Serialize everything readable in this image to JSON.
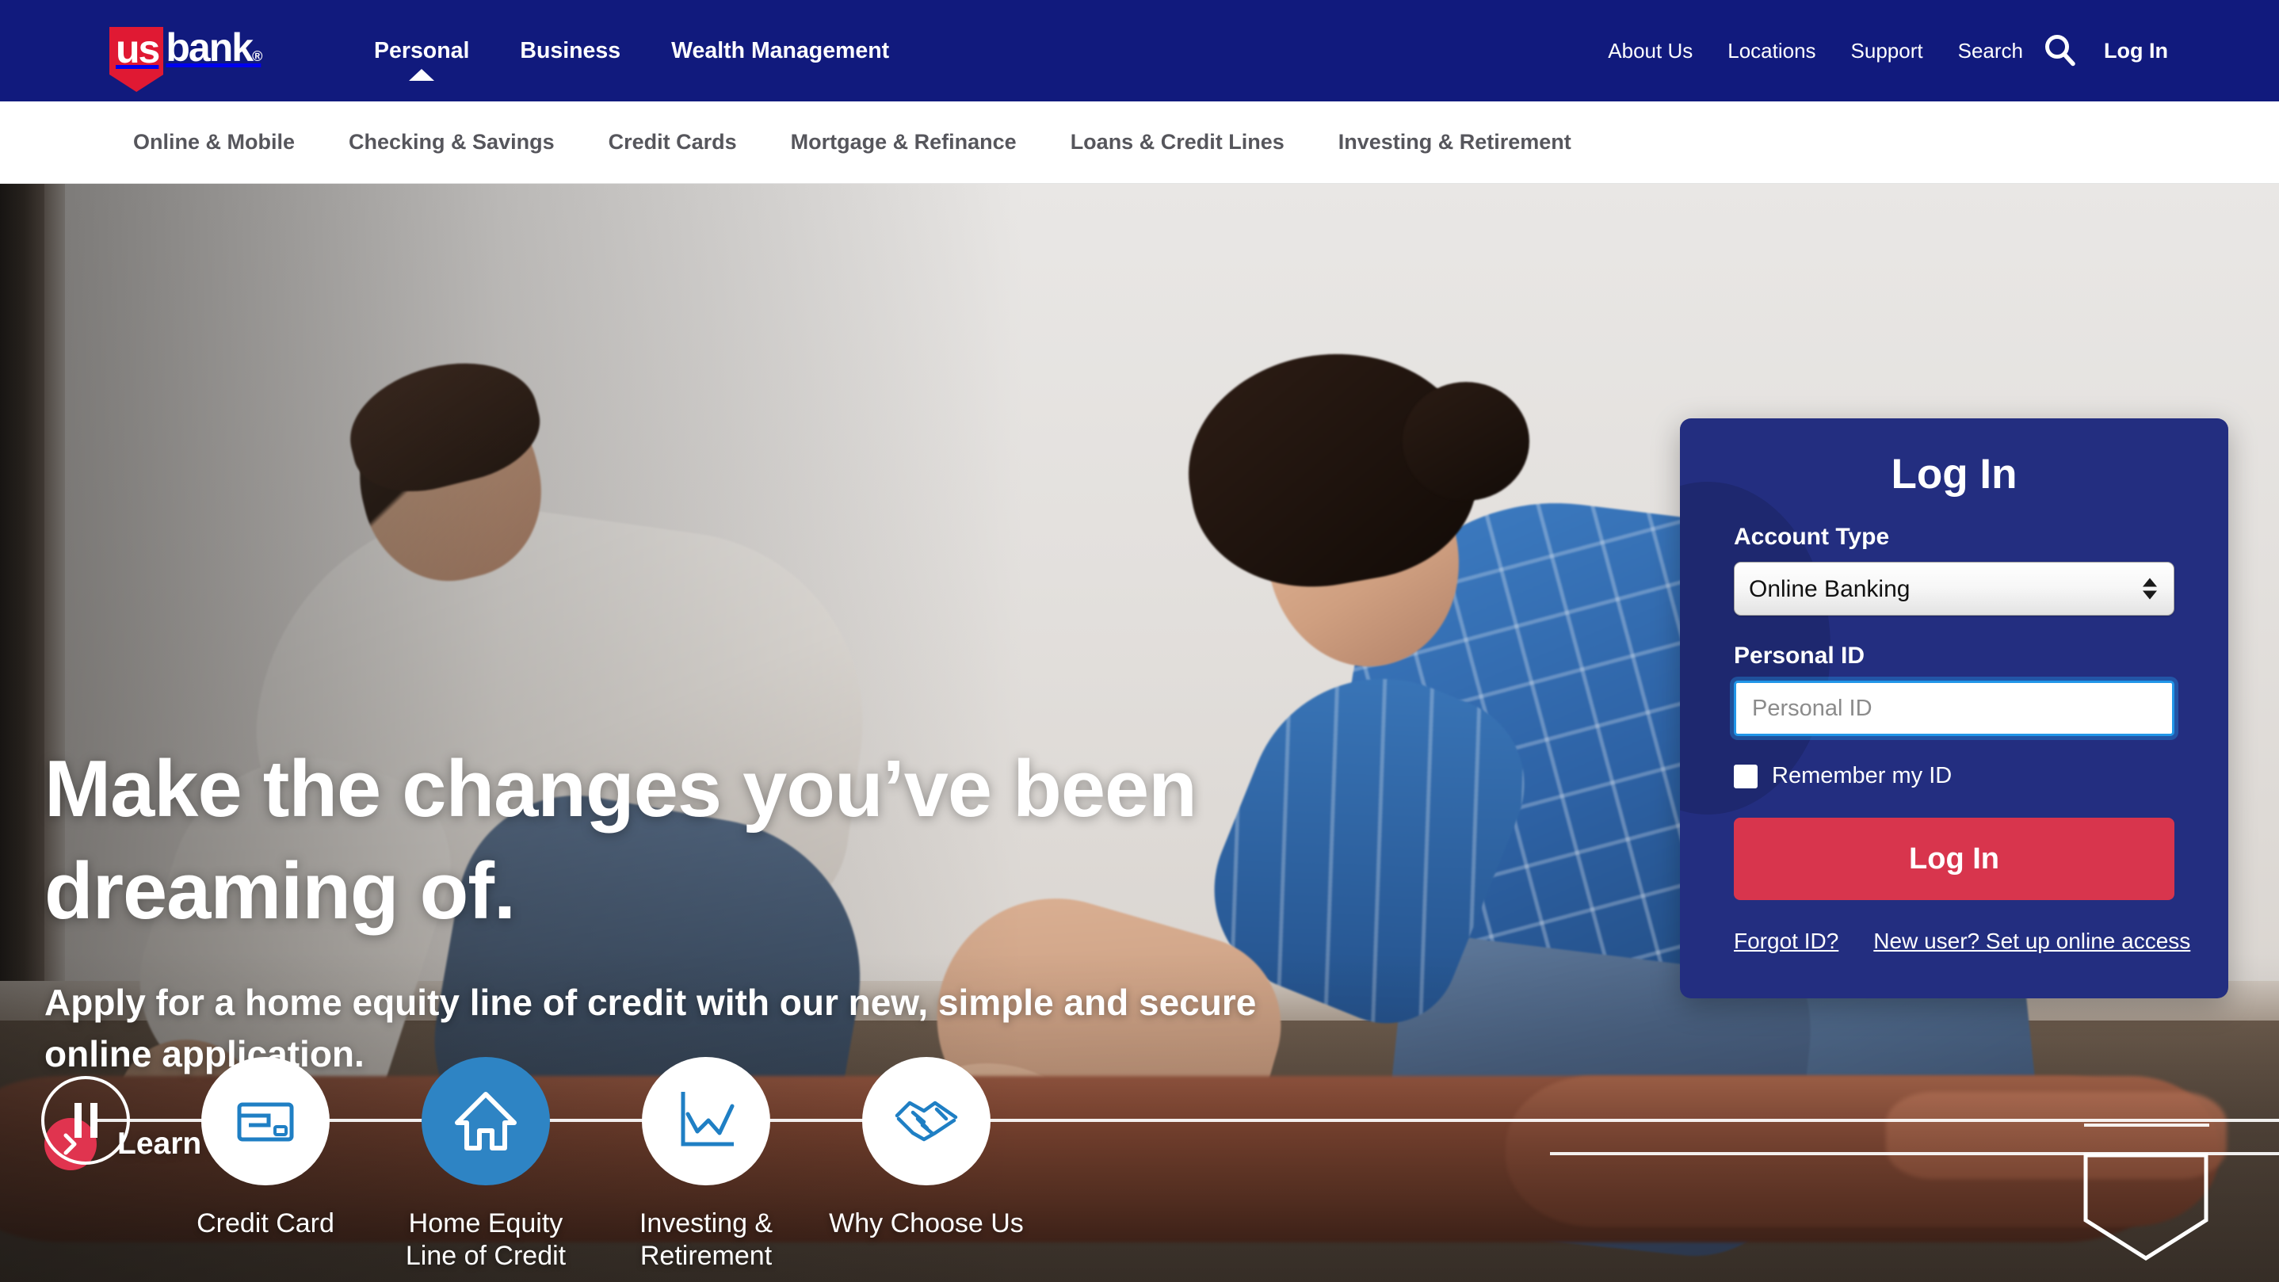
{
  "header": {
    "logo": {
      "us": "us",
      "bank": "bank",
      "mark": "®"
    },
    "main_nav": [
      {
        "label": "Personal",
        "active": true
      },
      {
        "label": "Business",
        "active": false
      },
      {
        "label": "Wealth Management",
        "active": false
      }
    ],
    "util_nav": [
      {
        "label": "About Us",
        "bold": false
      },
      {
        "label": "Locations",
        "bold": false
      },
      {
        "label": "Support",
        "bold": false
      },
      {
        "label": "Search",
        "bold": false
      }
    ],
    "search_icon": "search-icon",
    "login_label": "Log In"
  },
  "subnav": {
    "items": [
      {
        "label": "Online & Mobile"
      },
      {
        "label": "Checking & Savings"
      },
      {
        "label": "Credit Cards"
      },
      {
        "label": "Mortgage & Refinance"
      },
      {
        "label": "Loans & Credit Lines"
      },
      {
        "label": "Investing & Retirement"
      }
    ]
  },
  "hero": {
    "headline": "Make the changes you’ve been dreaming of.",
    "subheadline": "Apply for a home equity line of credit with our new, simple and secure online application.",
    "cta_label": "Learn more",
    "cta_icon": "chevron-right-icon"
  },
  "login": {
    "title": "Log In",
    "account_type_label": "Account Type",
    "account_type_value": "Online Banking",
    "account_type_options": [
      "Online Banking"
    ],
    "personal_id_label": "Personal ID",
    "personal_id_value": "",
    "personal_id_placeholder": "Personal ID",
    "remember_label": "Remember my ID",
    "remember_checked": false,
    "submit_label": "Log In",
    "forgot_link": "Forgot ID?",
    "new_user_link": "New user? Set up online access"
  },
  "carousel": {
    "pause_icon": "pause-icon",
    "slides": [
      {
        "label": "Credit Card",
        "icon": "credit-card-icon",
        "active": false
      },
      {
        "label": "Home Equity\nLine of Credit",
        "icon": "house-icon",
        "active": true
      },
      {
        "label": "Investing &\nRetirement",
        "icon": "line-chart-icon",
        "active": false
      },
      {
        "label": "Why Choose Us",
        "icon": "handshake-icon",
        "active": false
      }
    ]
  },
  "colors": {
    "header_navy": "#111a7d",
    "panel_navy": "#232e80",
    "accent_red": "#d8354d",
    "logo_red": "#e01933",
    "active_blue": "#2e84c4",
    "focus_blue": "#2196e8",
    "subnav_text": "#56565c"
  }
}
